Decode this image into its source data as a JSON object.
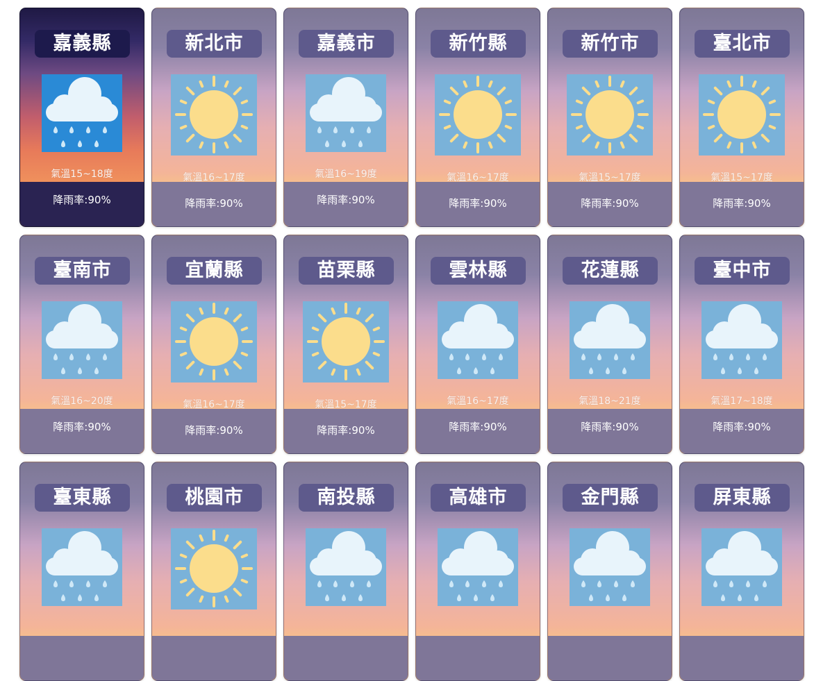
{
  "cards": [
    {
      "city": "嘉義縣",
      "weather": "rain-icon",
      "temp": "氣溫15~18度",
      "rain": "降雨率:90%",
      "active": true
    },
    {
      "city": "新北市",
      "weather": "sun-icon",
      "temp": "氣溫16~17度",
      "rain": "降雨率:90%"
    },
    {
      "city": "嘉義市",
      "weather": "rain-icon",
      "temp": "氣溫16~19度",
      "rain": "降雨率:90%"
    },
    {
      "city": "新竹縣",
      "weather": "sun-icon",
      "temp": "氣溫16~17度",
      "rain": "降雨率:90%"
    },
    {
      "city": "新竹市",
      "weather": "sun-icon",
      "temp": "氣溫15~17度",
      "rain": "降雨率:90%"
    },
    {
      "city": "臺北市",
      "weather": "sun-icon",
      "temp": "氣溫15~17度",
      "rain": "降雨率:90%"
    },
    {
      "city": "臺南市",
      "weather": "rain-icon",
      "temp": "氣溫16~20度",
      "rain": "降雨率:90%"
    },
    {
      "city": "宜蘭縣",
      "weather": "sun-icon",
      "temp": "氣溫16~17度",
      "rain": "降雨率:90%"
    },
    {
      "city": "苗栗縣",
      "weather": "sun-icon",
      "temp": "氣溫15~17度",
      "rain": "降雨率:90%"
    },
    {
      "city": "雲林縣",
      "weather": "rain-icon",
      "temp": "氣溫16~17度",
      "rain": "降雨率:90%"
    },
    {
      "city": "花蓮縣",
      "weather": "rain-icon",
      "temp": "氣溫18~21度",
      "rain": "降雨率:90%"
    },
    {
      "city": "臺中市",
      "weather": "rain-icon",
      "temp": "氣溫17~18度",
      "rain": "降雨率:90%"
    },
    {
      "city": "臺東縣",
      "weather": "rain-icon"
    },
    {
      "city": "桃園市",
      "weather": "sun-icon"
    },
    {
      "city": "南投縣",
      "weather": "rain-icon"
    },
    {
      "city": "高雄市",
      "weather": "rain-icon"
    },
    {
      "city": "金門縣",
      "weather": "rain-icon"
    },
    {
      "city": "屏東縣",
      "weather": "rain-icon"
    }
  ],
  "colors": {
    "card_top": "#7e7896",
    "card_bottom_band": "#7f7698",
    "active_top": "#1f1944",
    "active_band": "#2a2352",
    "city_badge": "#5e5a8c",
    "icon_bg": "#7ab2d9",
    "sun": "#fbdd8c",
    "cloud": "#e8f4fb",
    "raindrop": "#cfe8f7"
  }
}
